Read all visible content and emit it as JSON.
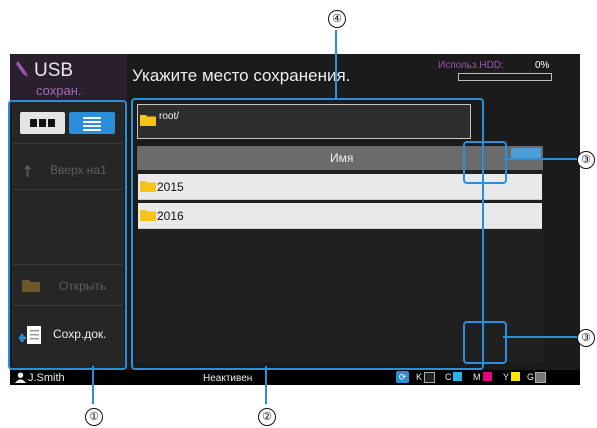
{
  "title": {
    "main": "USB",
    "sub": "сохран."
  },
  "heading": "Укажите место сохранения.",
  "hdd": {
    "label": "Использ.HDD:",
    "value": "0%",
    "fill_fraction": 0
  },
  "side_panel": {
    "up_label": "Вверх на1",
    "open_label": "Открыть",
    "save_label": "Сохр.док."
  },
  "path": "root/",
  "list": {
    "column_header": "Имя",
    "rows": [
      "2015",
      "2016"
    ]
  },
  "status_bar": {
    "user": "J.Smith",
    "state": "Неактивен",
    "inks": [
      {
        "label": "K",
        "color": "#222222"
      },
      {
        "label": "C",
        "color": "#25b6e6"
      },
      {
        "label": "M",
        "color": "#e5007f"
      },
      {
        "label": "Y",
        "color": "#ffe600"
      },
      {
        "label": "G",
        "color": "#777777"
      }
    ]
  },
  "callouts": [
    "①",
    "②",
    "③",
    "③",
    "④"
  ],
  "colors": {
    "accent": "#2a8fd8",
    "title_purple": "#a46bb4",
    "folder_yellow": "#f6c51a"
  }
}
